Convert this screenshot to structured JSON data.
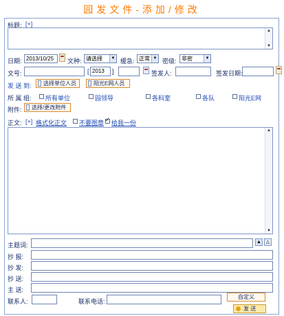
{
  "window": {
    "title": "园发文件-添加/修改"
  },
  "form": {
    "title_label": "标题:",
    "title_expand": "[+]",
    "date_label": "日期:",
    "date_value": "2013/10/25",
    "doc_type_label": "文种:",
    "doc_type_value": "请选择",
    "urgency_label": "缓急:",
    "urgency_value": "正常",
    "secret_label": "密级:",
    "secret_value": "非密",
    "doc_no_label": "文号:",
    "doc_no_year": "2013",
    "doc_no_bracket_open": "[",
    "doc_no_bracket_close": "]",
    "signer_label": "签发人:",
    "sign_date_label": "签发日期:",
    "send_to_label": "发 送 到:",
    "select_unit_btn": "选择单位人员",
    "select_yg_btn": "阳光E网人员",
    "group_label": "所 属 组:",
    "groups": [
      "所有单位",
      "园领导",
      "各科室",
      "各队",
      "阳光E网"
    ],
    "attach_label": "附件:",
    "attach_btn": "选择/更改附件",
    "body_label": "正文:",
    "body_expand": "[+]",
    "format_body_link": "格式化正文",
    "no_stamp_label": "不要图章",
    "give_me_label": "给我一份",
    "no_stamp_checked": false,
    "give_me_checked": true,
    "keywords_label": "主题词:",
    "cc_label": "抄 报:",
    "cc_send_label": "抄 发:",
    "cc_to_label": "抄 送:",
    "main_send_label": "主 送:",
    "contact_label": "联系人:",
    "phone_label": "联系电话:",
    "custom_btn": "自定义",
    "send_btn": "发  送"
  },
  "colors": {
    "accent": "#ff7a00",
    "border": "#8aa3d3",
    "label": "#1a2f6a",
    "link": "#1f4bb5"
  }
}
